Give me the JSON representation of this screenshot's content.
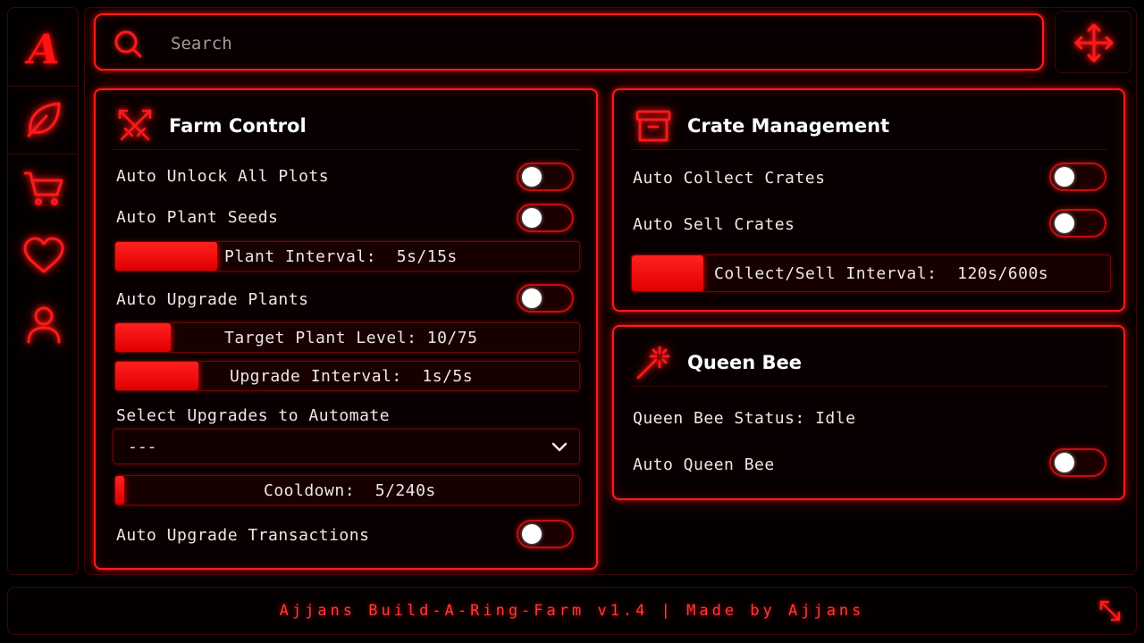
{
  "app": {
    "logo_letter": "A",
    "accent_color": "#ff1a1a"
  },
  "sidebar": {
    "items": [
      {
        "icon": "logo-icon"
      },
      {
        "icon": "leaf-icon"
      },
      {
        "icon": "cart-icon"
      },
      {
        "icon": "heart-icon"
      },
      {
        "icon": "user-icon"
      }
    ]
  },
  "search": {
    "placeholder": "Search",
    "value": ""
  },
  "farm_control": {
    "title": "Farm Control",
    "icon": "crossed-swords-icon",
    "auto_unlock": {
      "label": "Auto Unlock All Plots",
      "on": false
    },
    "auto_plant": {
      "label": "Auto Plant Seeds",
      "on": false
    },
    "plant_interval": {
      "label": "Plant Interval:",
      "value": "5s/15s",
      "fraction": 0.22
    },
    "auto_upgrade": {
      "label": "Auto Upgrade Plants",
      "on": false
    },
    "target_level": {
      "label": "Target Plant Level:",
      "value": "10/75",
      "fraction": 0.12
    },
    "upgrade_interval": {
      "label": "Upgrade Interval:",
      "value": "1s/5s",
      "fraction": 0.18
    },
    "select_upgrades": {
      "label": "Select Upgrades to Automate",
      "selected": "---"
    },
    "cooldown": {
      "label": "Cooldown:",
      "value": "5/240s",
      "fraction": 0.02
    },
    "auto_transactions": {
      "label": "Auto Upgrade Transactions",
      "on": false
    }
  },
  "crate_management": {
    "title": "Crate Management",
    "icon": "archive-box-icon",
    "auto_collect": {
      "label": "Auto Collect Crates",
      "on": false
    },
    "auto_sell": {
      "label": "Auto Sell Crates",
      "on": false
    },
    "interval": {
      "label": "Collect/Sell Interval:",
      "value": "120s/600s",
      "fraction": 0.15
    }
  },
  "queen_bee": {
    "title": "Queen Bee",
    "icon": "magic-wand-icon",
    "status_label": "Queen Bee Status:",
    "status_value": "Idle",
    "auto_queen": {
      "label": "Auto Queen Bee",
      "on": false
    }
  },
  "footer": {
    "text": "Ajjans Build-A-Ring-Farm v1.4 | Made by Ajjans"
  }
}
